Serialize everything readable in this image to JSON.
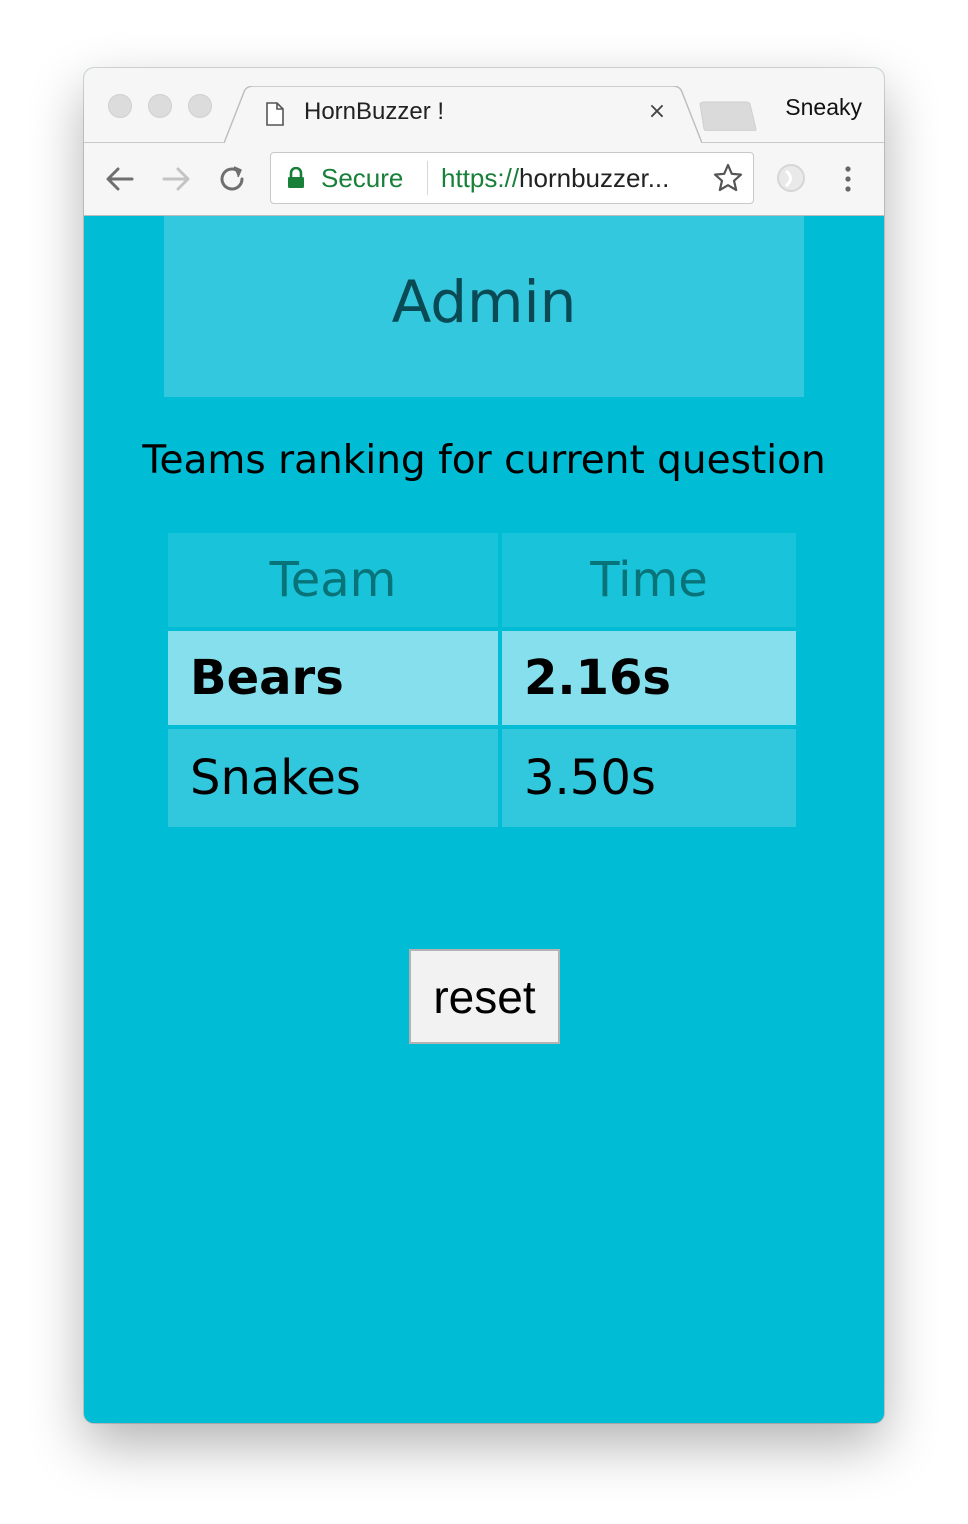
{
  "browser": {
    "tab_title": "HornBuzzer !",
    "tab_close": "×",
    "profile_name": "Sneaky",
    "secure_label": "Secure",
    "url_scheme": "https://",
    "url_host": "hornbuzzer..."
  },
  "page": {
    "header_title": "Admin",
    "subtitle": "Teams ranking for current question",
    "table": {
      "columns": [
        "Team",
        "Time"
      ],
      "rows": [
        {
          "team": "Bears",
          "time": "2.16s"
        },
        {
          "team": "Snakes",
          "time": "3.50s"
        }
      ]
    },
    "reset_label": "reset"
  },
  "colors": {
    "page_background": "#00bcd4",
    "header_background": "#33c8dd",
    "first_row_background": "#85dfec",
    "secure_green": "#188038"
  }
}
